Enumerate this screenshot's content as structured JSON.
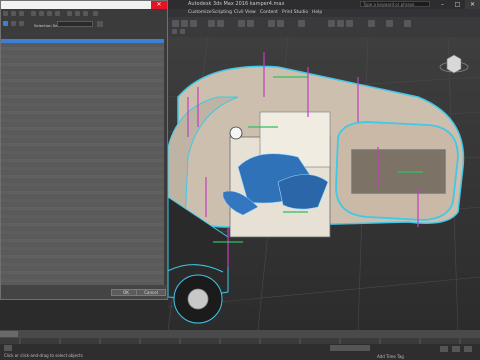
{
  "window": {
    "title": "Autodesk 3ds Max 2016    kamper4.max",
    "search_placeholder": "Type a keyword or phrase",
    "controls": [
      "–",
      "□",
      "✕"
    ]
  },
  "menu": [
    "Customize",
    "Scripting",
    "Civil View",
    "Content",
    "Print Studio",
    "Help"
  ],
  "dialog": {
    "selection_set_label": "Selection Set:",
    "ok_label": "OK",
    "cancel_label": "Cancel",
    "close_glyph": "✕"
  },
  "status": {
    "prompt": "Click or click-and-drag to select objects",
    "add_time_tag": "Add Time Tag"
  },
  "colors": {
    "accent_blue": "#3d7fd6",
    "close_red": "#e81123",
    "gizmo_magenta": "#c040c0",
    "gizmo_green": "#30c060",
    "wire_cyan": "#40c8e8"
  },
  "icons": [
    "viewcube-icon",
    "search-icon",
    "minimize-icon",
    "maximize-icon",
    "close-icon"
  ]
}
